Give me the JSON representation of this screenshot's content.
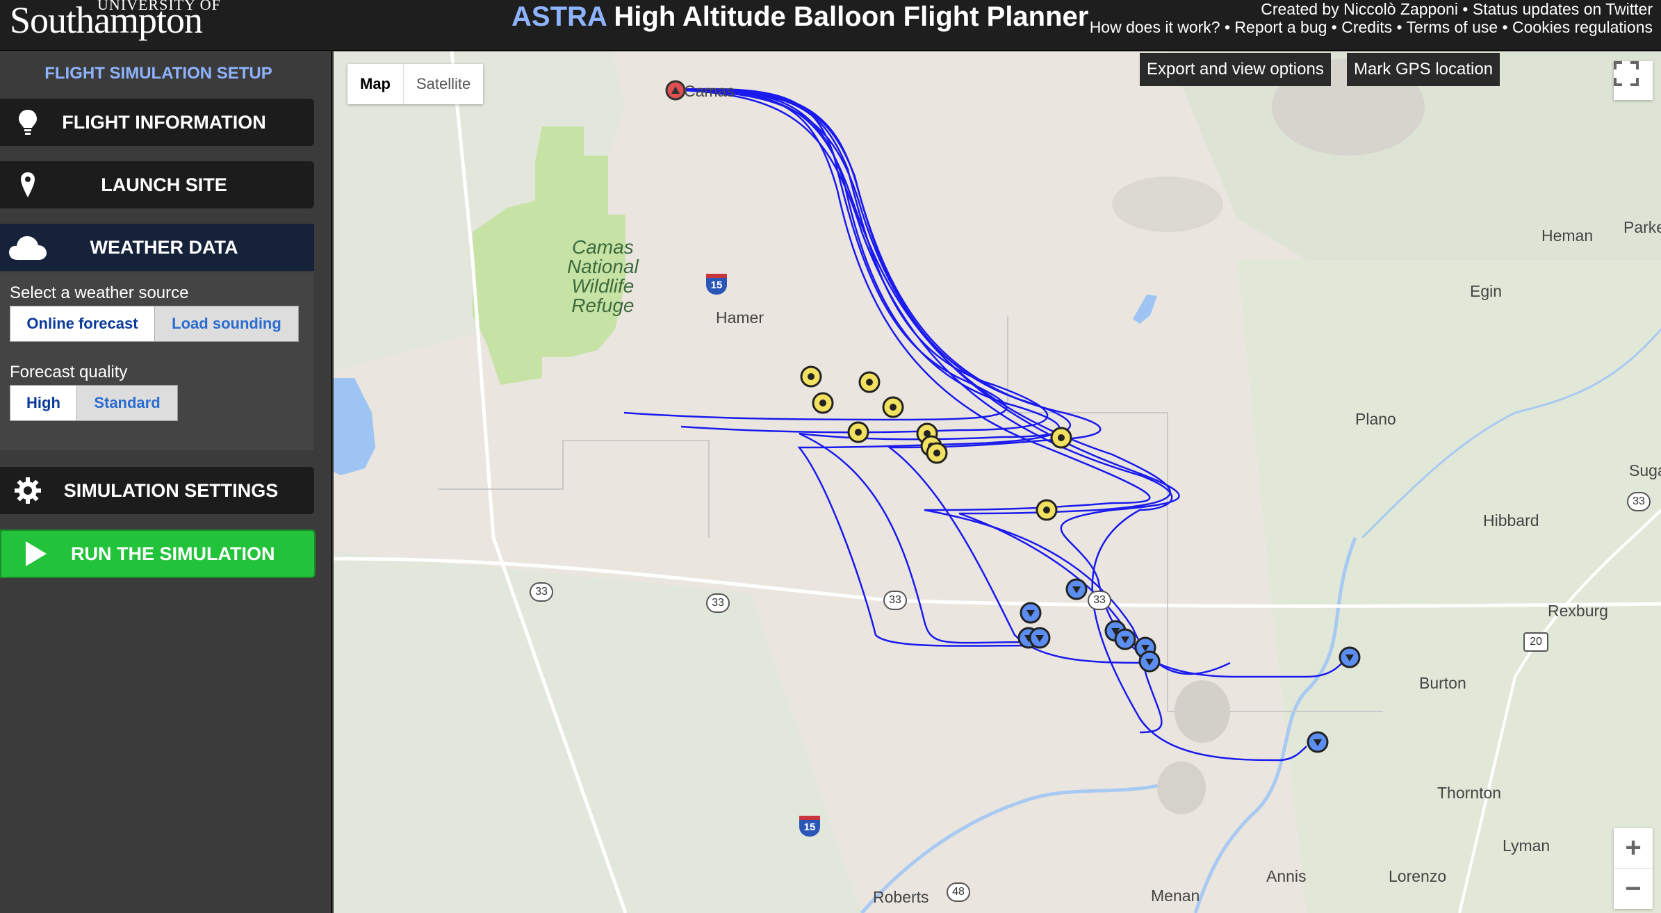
{
  "header": {
    "logo_small": "UNIVERSITY OF",
    "logo_big": "Southampton",
    "title_prefix": "ASTRA",
    "title_rest": "High Altitude Balloon Flight Planner",
    "line1": "Created by Niccolò Zapponi • Status updates on Twitter",
    "line2": "How does it work? • Report a bug • Credits • Terms of use • Cookies regulations"
  },
  "sidebar": {
    "setup_title": "FLIGHT SIMULATION SETUP",
    "flight_info": "FLIGHT INFORMATION",
    "launch_site": "LAUNCH SITE",
    "weather_data": "WEATHER DATA",
    "weather_source_label": "Select a weather source",
    "online_forecast": "Online forecast",
    "load_sounding": "Load sounding",
    "forecast_quality_label": "Forecast quality",
    "quality_high": "High",
    "quality_standard": "Standard",
    "simulation_settings": "SIMULATION SETTINGS",
    "run": "RUN THE SIMULATION"
  },
  "map": {
    "type_map": "Map",
    "type_satellite": "Satellite",
    "export_btn": "Export and view options",
    "gps_btn": "Mark GPS location",
    "zoom_in": "+",
    "zoom_out": "−",
    "refuge": "Camas\nNational\nWildlife\nRefuge",
    "places": {
      "camas": "Camas",
      "hamer": "Hamer",
      "heman": "Heman",
      "parker": "Parke",
      "egin": "Egin",
      "plano": "Plano",
      "sugar": "Suga",
      "hibbard": "Hibbard",
      "rexburg": "Rexburg",
      "burton": "Burton",
      "thornton": "Thornton",
      "lyman": "Lyman",
      "annis": "Annis",
      "lorenzo": "Lorenzo",
      "roberts": "Roberts",
      "menan": "Menan"
    },
    "shields": {
      "i15": "15",
      "r33": "33",
      "r20": "20",
      "r48": "48"
    }
  },
  "colors": {
    "track": "#1a1aee",
    "launch_marker": "#e05050",
    "burst_marker": "#f2e060",
    "landing_marker": "#5b8ef0",
    "run_green": "#22c23a"
  }
}
